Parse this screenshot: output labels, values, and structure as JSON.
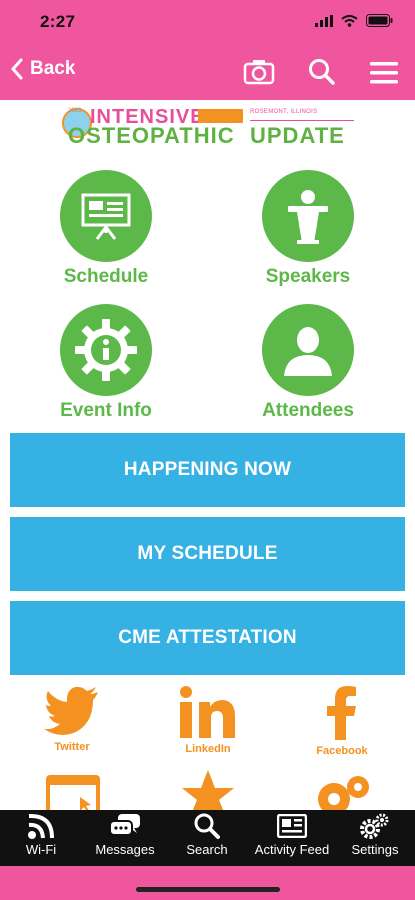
{
  "status": {
    "time": "2:27"
  },
  "nav": {
    "back_label": "Back"
  },
  "banner": {
    "year": "2023",
    "line1": "INTENSIVE",
    "line2": "OSTEOPATHIC",
    "line3": "UPDATE",
    "location": "ROSEMONT, ILLINOIS"
  },
  "tiles": [
    {
      "label": "Schedule",
      "icon": "presentation-board-icon"
    },
    {
      "label": "Speakers",
      "icon": "podium-speaker-icon"
    },
    {
      "label": "Event Info",
      "icon": "info-gear-icon"
    },
    {
      "label": "Attendees",
      "icon": "person-silhouette-icon"
    }
  ],
  "buttons": [
    "HAPPENING NOW",
    "MY SCHEDULE",
    "CME ATTESTATION"
  ],
  "social": [
    {
      "label": "Twitter",
      "icon": "twitter-bird-icon"
    },
    {
      "label": "LinkedIn",
      "icon": "linkedin-icon"
    },
    {
      "label": "Facebook",
      "icon": "facebook-icon"
    }
  ],
  "tabs": [
    {
      "label": "Wi-Fi",
      "icon": "wifi-icon"
    },
    {
      "label": "Messages",
      "icon": "messages-icon"
    },
    {
      "label": "Search",
      "icon": "search-icon"
    },
    {
      "label": "Activity Feed",
      "icon": "activity-feed-icon"
    },
    {
      "label": "Settings",
      "icon": "settings-icon"
    }
  ],
  "colors": {
    "brand_pink": "#f0569e",
    "tile_green": "#5cb848",
    "button_blue": "#36b1e4",
    "social_orange": "#f39221",
    "tabbar_black": "#111111"
  }
}
